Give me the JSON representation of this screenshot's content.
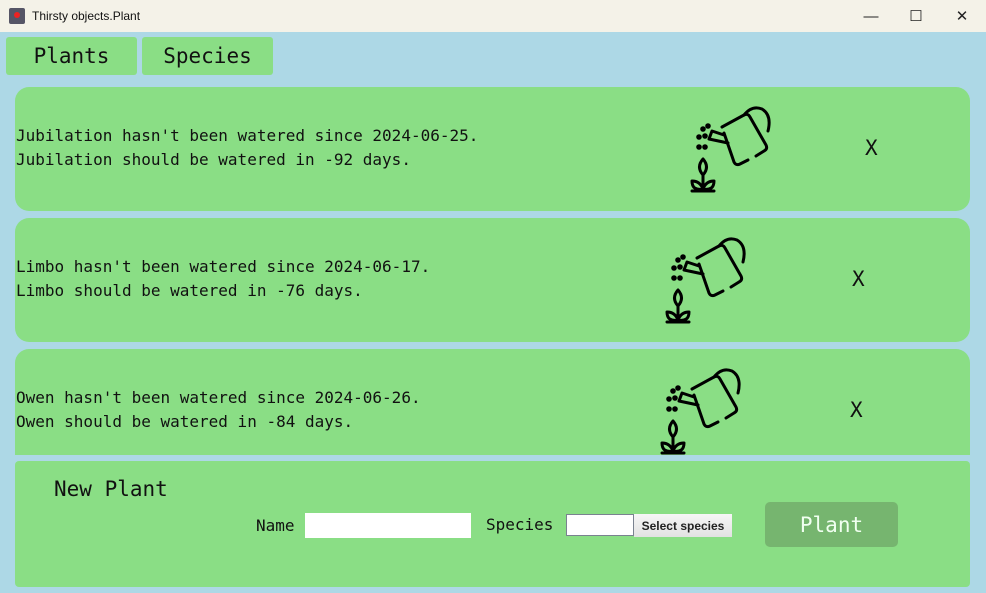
{
  "window": {
    "title": "Thirsty objects.Plant",
    "minimize": "—",
    "maximize": "☐",
    "close": "✕"
  },
  "tabs": [
    {
      "label": "Plants"
    },
    {
      "label": "Species"
    }
  ],
  "plants": [
    {
      "line1": "Jubilation hasn't been watered since 2024-06-25.",
      "line2": "Jubilation should be watered in -92 days.",
      "delete": "X"
    },
    {
      "line1": "Limbo hasn't been watered since 2024-06-17.",
      "line2": "Limbo should be watered in -76 days.",
      "delete": "X"
    },
    {
      "line1": "Owen hasn't been watered since 2024-06-26.",
      "line2": "Owen should be watered in -84 days.",
      "delete": "X"
    }
  ],
  "new_plant": {
    "title": "New Plant",
    "name_label": "Name",
    "name_value": "",
    "species_label": "Species",
    "species_value": "",
    "select_species": "Select species",
    "plant_button": "Plant"
  },
  "colors": {
    "background": "#add8e6",
    "card": "#8ade85",
    "plant_button": "#76b56f"
  }
}
